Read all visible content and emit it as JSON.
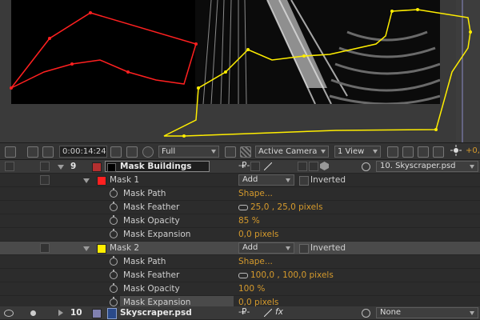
{
  "toolbar": {
    "timecode": "0:00:14:24",
    "resolution": "Full",
    "camera": "Active Camera",
    "view_layout": "1 View",
    "exposure": "+0,"
  },
  "layers": [
    {
      "number": "9",
      "name": "Mask Buildings",
      "parent": "10. Skyscraper.psd",
      "label_color": "#b43030",
      "masks": [
        {
          "name": "Mask 1",
          "color": "#ff2020",
          "mode": "Add",
          "inverted_label": "Inverted",
          "properties": [
            {
              "name": "Mask Path",
              "value": "Shape..."
            },
            {
              "name": "Mask Feather",
              "value": "25,0 , 25,0 pixels"
            },
            {
              "name": "Mask Opacity",
              "value": "85 %"
            },
            {
              "name": "Mask Expansion",
              "value": "0,0 pixels"
            }
          ]
        },
        {
          "name": "Mask 2",
          "color": "#ffee00",
          "mode": "Add",
          "inverted_label": "Inverted",
          "properties": [
            {
              "name": "Mask Path",
              "value": "Shape..."
            },
            {
              "name": "Mask Feather",
              "value": "100,0 , 100,0 pixels"
            },
            {
              "name": "Mask Opacity",
              "value": "100 %"
            },
            {
              "name": "Mask Expansion",
              "value": "0,0 pixels"
            }
          ]
        }
      ]
    },
    {
      "number": "10",
      "name": "Skyscraper.psd",
      "parent": "None",
      "label_color": "#8080b0"
    }
  ],
  "icons": {
    "fx": "fx",
    "mask_path_color_1": "#ff2020",
    "mask_path_color_2": "#ffee00"
  }
}
